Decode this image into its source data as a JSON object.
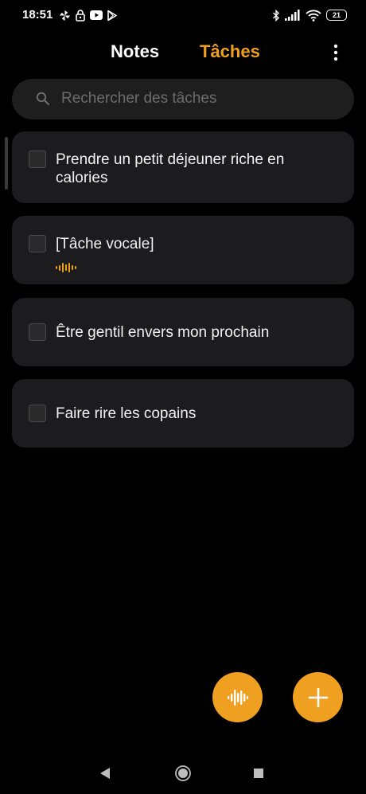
{
  "status_bar": {
    "time": "18:51",
    "battery": "21",
    "left_icons": [
      "pinwheel-icon",
      "lock-icon",
      "youtube-icon",
      "play-store-icon"
    ],
    "right_icons": [
      "bluetooth-icon",
      "signal-icon",
      "wifi-icon",
      "battery-icon"
    ]
  },
  "header": {
    "tabs": [
      {
        "label": "Notes",
        "active": false
      },
      {
        "label": "Tâches",
        "active": true
      }
    ],
    "more_icon": "more-vertical-icon"
  },
  "search": {
    "placeholder": "Rechercher des tâches",
    "value": "",
    "icon": "search-icon"
  },
  "tasks": [
    {
      "text": "Prendre un petit déjeuner riche en calories",
      "checked": false,
      "voice": false
    },
    {
      "text": "[Tâche vocale]",
      "checked": false,
      "voice": true
    },
    {
      "text": "Être gentil envers mon prochain",
      "checked": false,
      "voice": false
    },
    {
      "text": "Faire rire les copains",
      "checked": false,
      "voice": false
    }
  ],
  "fabs": {
    "voice_icon": "voice-wave-icon",
    "add_icon": "plus-icon"
  },
  "nav": [
    "back-icon",
    "home-icon",
    "recents-icon"
  ],
  "colors": {
    "accent": "#f0a020",
    "background": "#000000",
    "card": "#1c1c1e",
    "search_bg": "#1e1e1e",
    "placeholder": "#6c6c6c"
  }
}
